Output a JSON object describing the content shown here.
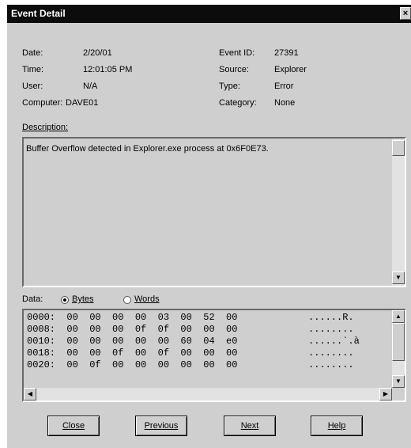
{
  "window": {
    "title": "Event Detail",
    "close_glyph": "×"
  },
  "fields": {
    "date_label": "Date:",
    "date_value": "2/20/01",
    "time_label": "Time:",
    "time_value": "12:01:05 PM",
    "user_label": "User:",
    "user_value": "N/A",
    "computer_label": "Computer:",
    "computer_value": "DAVE01",
    "eventid_label": "Event ID:",
    "eventid_value": "27391",
    "source_label": "Source:",
    "source_value": "Explorer",
    "type_label": "Type:",
    "type_value": "Error",
    "category_label": "Category:",
    "category_value": "None"
  },
  "description": {
    "label": "Description:",
    "text": "Buffer Overflow detected in Explorer.exe process at 0x6F0E73."
  },
  "data_section": {
    "label": "Data:",
    "bytes_label": "Bytes",
    "words_label": "Words",
    "selected": "Bytes",
    "rows": [
      {
        "hex": "0000:  00  00  00  00  03  00  52  00",
        "ascii": "......R."
      },
      {
        "hex": "0008:  00  00  00  0f  0f  00  00  00",
        "ascii": "........"
      },
      {
        "hex": "0010:  00  00  00  00  00  60  04  e0",
        "ascii": "......`.à"
      },
      {
        "hex": "0018:  00  00  0f  00  0f  00  00  00",
        "ascii": "........"
      },
      {
        "hex": "0020:  00  0f  00  00  00  00  00  00",
        "ascii": "........"
      }
    ]
  },
  "buttons": {
    "close": "Close",
    "previous": "Previous",
    "next": "Next",
    "help": "Help"
  }
}
